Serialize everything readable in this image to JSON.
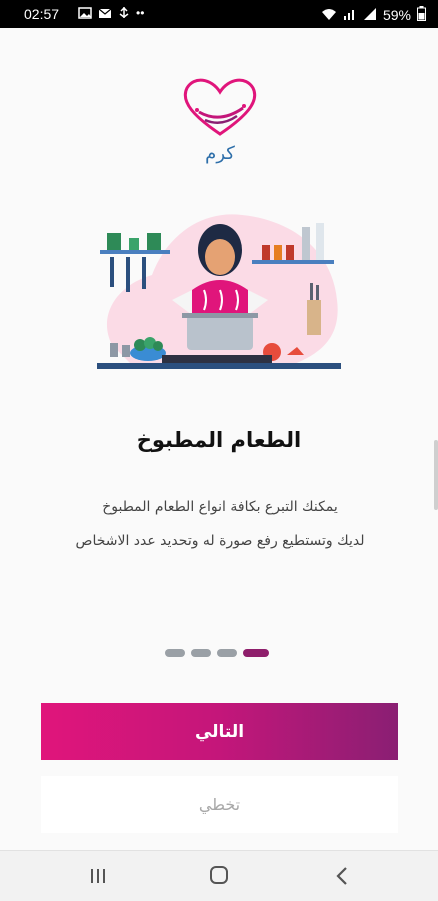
{
  "status_bar": {
    "time": "02:57",
    "battery": "59%"
  },
  "logo": {
    "text": "كرم"
  },
  "onboarding": {
    "title": "الطعام المطبوخ",
    "description_line1": "يمكنك التبرع بكافة انواع الطعام المطبوخ",
    "description_line2": "لديك وتستطيع رفع صورة له وتحديد عدد الاشخاص",
    "pages": 4,
    "current_page": 4
  },
  "buttons": {
    "next": "التالي",
    "skip": "تخطي"
  },
  "colors": {
    "brand_pink": "#e0157b",
    "brand_purple": "#8a1f73",
    "logo_text": "#2d6ea9"
  },
  "nav": {
    "recent_icon": "recent-apps-icon",
    "home_icon": "home-icon",
    "back_icon": "back-icon"
  }
}
